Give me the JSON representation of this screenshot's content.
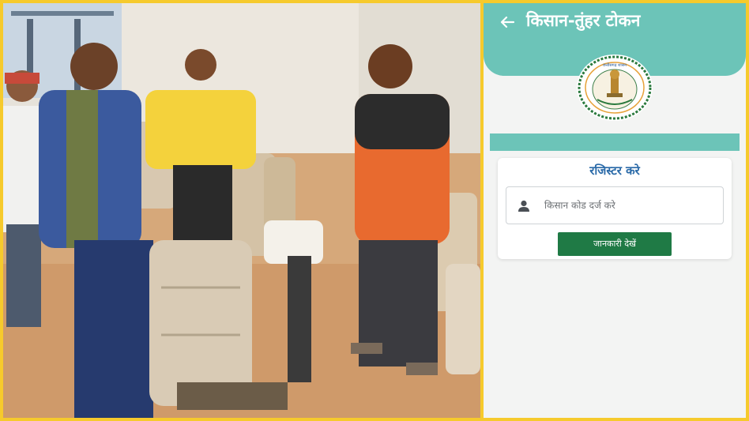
{
  "colors": {
    "frame": "#f6ca2c",
    "header": "#6cc4b8",
    "card_title": "#2a6aa8",
    "button": "#1f7a45"
  },
  "photo": {
    "content": "farmers weighing paddy sacks"
  },
  "app": {
    "title": "किसान-तुंहर टोकन",
    "back_icon": "arrow-left-icon",
    "emblem": "chhattisgarh-government-emblem",
    "emblem_text": "छत्तीसगढ़ शासन"
  },
  "form": {
    "heading": "रजिस्टर करे",
    "input_icon": "person-icon",
    "input_placeholder": "किसान कोड दर्ज करे",
    "button_label": "जानकारी देखें"
  }
}
